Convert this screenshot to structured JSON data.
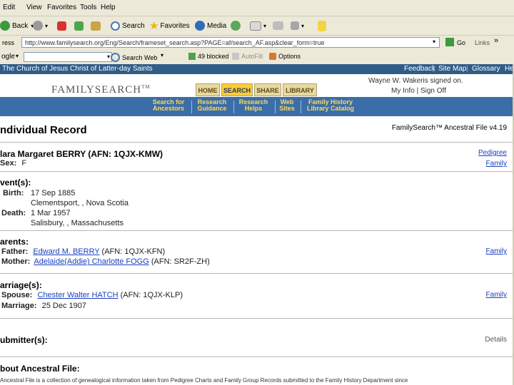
{
  "menu": [
    "Edit",
    "View",
    "Favorites",
    "Tools",
    "Help"
  ],
  "toolbar": {
    "back": "Back",
    "search": "Search",
    "favorites": "Favorites",
    "media": "Media"
  },
  "address": {
    "label": "ress",
    "url": "http://www.familysearch.org/Eng/Search/frameset_search.asp?PAGE=af/search_AF.asp&clear_form=true",
    "go": "Go",
    "links": "Links",
    "chevron": "»"
  },
  "googlebar": {
    "label": "ogle",
    "search_web": "Search Web",
    "popups": "49 blocked",
    "autofill": "AutoFill",
    "options": "Options"
  },
  "site": {
    "church": "The Church of Jesus Christ of Latter-day Saints",
    "top_links": [
      "Feedback",
      "Site Map",
      "Glossary",
      "He"
    ],
    "logo_text": "FAMILYSEARCH",
    "logo_tm": "TM",
    "tabs": [
      "HOME",
      "SEARCH",
      "SHARE",
      "LIBRARY"
    ],
    "signed_in": "Wayne W. Wakeris signed on.",
    "my_info": "My Info",
    "sign_off": "Sign Off",
    "nav": [
      {
        "l1": "Search for",
        "l2": "Ancestors"
      },
      {
        "l1": "Research",
        "l2": "Guidance"
      },
      {
        "l1": "Research",
        "l2": "Helps"
      },
      {
        "l1": "Web",
        "l2": "Sites"
      },
      {
        "l1": "Family History",
        "l2": "Library Catalog"
      }
    ]
  },
  "record": {
    "title": "ndividual Record",
    "source": "FamilySearch™ Ancestral File v4.19",
    "name": "lara Margaret BERRY (AFN: 1QJX-KMW)",
    "sex_label": "Sex:",
    "sex_value": "F",
    "pedigree": "Pedigree",
    "family": "Family",
    "events_heading": "vent(s):",
    "birth_label": "Birth:",
    "birth_date": "17 Sep 1885",
    "birth_place": "Clementsport, , Nova Scotia",
    "death_label": "Death:",
    "death_date": "1 Mar 1957",
    "death_place": "Salisbury, , Massachusetts",
    "parents_heading": "arents:",
    "father_label": "Father:",
    "father_name": "Edward M. BERRY",
    "father_afn": "(AFN: 1QJX-KFN)",
    "mother_label": "Mother:",
    "mother_name": "Adelaide(Addie) Charlotte FOGG",
    "mother_afn": "(AFN: SR2F-ZH)",
    "parents_family": "Family",
    "marriage_heading": "arriage(s):",
    "spouse_label": "Spouse:",
    "spouse_name": "Chester Walter HATCH",
    "spouse_afn": "(AFN: 1QJX-KLP)",
    "marriage_label": "Marriage:",
    "marriage_date": "25 Dec 1907",
    "marriage_family": "Family",
    "submitters_heading": "ubmitter(s):",
    "details": "Details",
    "about_heading": "bout Ancestral File:",
    "about_text": "Ancestral File is a collection of genealogical information taken from Pedigree Charts and Family Group Records submitted to the Family History Department since"
  }
}
